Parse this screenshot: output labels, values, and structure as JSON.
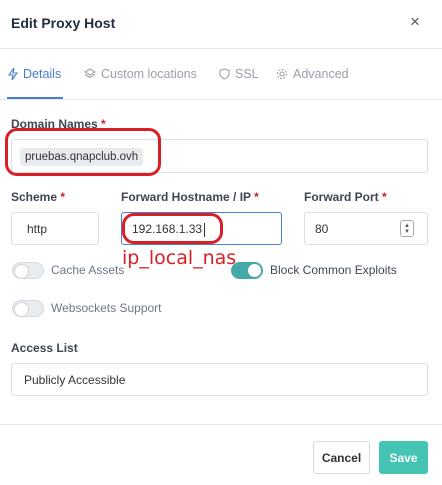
{
  "modal": {
    "title": "Edit Proxy Host",
    "close_glyph": "×"
  },
  "tabs": [
    {
      "label": "Details",
      "icon": "bolt-icon",
      "active": true
    },
    {
      "label": "Custom locations",
      "icon": "layers-icon",
      "active": false
    },
    {
      "label": "SSL",
      "icon": "shield-icon",
      "active": false
    },
    {
      "label": "Advanced",
      "icon": "gear-icon",
      "active": false
    }
  ],
  "form": {
    "domain_names": {
      "label": "Domain Names",
      "required_mark": "*",
      "chips": [
        "pruebas.qnapclub.ovh"
      ]
    },
    "scheme": {
      "label": "Scheme",
      "required_mark": "*",
      "value": "http"
    },
    "forward_hostname": {
      "label": "Forward Hostname / IP",
      "required_mark": "*",
      "value": "192.168.1.33"
    },
    "forward_port": {
      "label": "Forward Port",
      "required_mark": "*",
      "value": "80"
    },
    "cache_assets": {
      "label": "Cache Assets",
      "enabled": false
    },
    "block_exploits": {
      "label": "Block Common Exploits",
      "enabled": true
    },
    "websockets": {
      "label": "Websockets Support",
      "enabled": false
    },
    "access_list": {
      "label": "Access List",
      "value": "Publicly Accessible"
    }
  },
  "annotation": {
    "text": "ip_local_nas",
    "color": "#d81f26"
  },
  "footer": {
    "cancel_label": "Cancel",
    "save_label": "Save"
  },
  "colors": {
    "accent": "#467fcf",
    "save": "#45c3b3",
    "toggle_on": "#45aaa7",
    "required": "#cd201f"
  }
}
